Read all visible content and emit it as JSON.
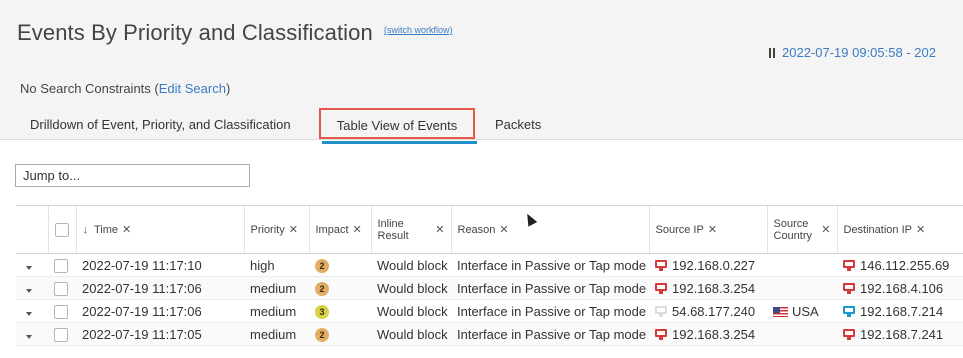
{
  "header": {
    "title": "Events By Priority and Classification",
    "switch_workflow": "(switch workflow)",
    "time_range": "2022-07-19 09:05:58 - 202",
    "constraints_prefix": "No Search Constraints (",
    "edit_search": "Edit Search",
    "constraints_suffix": ")"
  },
  "tabs": [
    {
      "label": "Drilldown of Event, Priority, and Classification"
    },
    {
      "label": "Table View of Events",
      "active": true
    },
    {
      "label": "Packets"
    }
  ],
  "jump_to": {
    "label": "Jump to..."
  },
  "table": {
    "columns": {
      "time": "Time",
      "priority": "Priority",
      "impact": "Impact",
      "inline_line1": "Inline",
      "inline_line2": "Result",
      "reason": "Reason",
      "source_ip": "Source IP",
      "source_country_line1": "Source",
      "source_country_line2": "Country",
      "destination_ip": "Destination IP"
    },
    "rows": [
      {
        "time": "2022-07-19 11:17:10",
        "priority": "high",
        "impact": "2",
        "inline_result": "Would block",
        "reason": "Interface in Passive or Tap mode",
        "source_ip": "192.168.0.227",
        "source_country": "",
        "destination_ip": "146.112.255.69"
      },
      {
        "time": "2022-07-19 11:17:06",
        "priority": "medium",
        "impact": "2",
        "inline_result": "Would block",
        "reason": "Interface in Passive or Tap mode",
        "source_ip": "192.168.3.254",
        "source_country": "",
        "destination_ip": "192.168.4.106"
      },
      {
        "time": "2022-07-19 11:17:06",
        "priority": "medium",
        "impact": "3",
        "inline_result": "Would block",
        "reason": "Interface in Passive or Tap mode",
        "source_ip": "54.68.177.240",
        "source_country": "USA",
        "destination_ip": "192.168.7.214"
      },
      {
        "time": "2022-07-19 11:17:05",
        "priority": "medium",
        "impact": "2",
        "inline_result": "Would block",
        "reason": "Interface in Passive or Tap mode",
        "source_ip": "192.168.3.254",
        "source_country": "",
        "destination_ip": "192.168.7.241"
      }
    ]
  },
  "colors": {
    "link": "#3a7cc4",
    "active_tab_border": "#e35a4a",
    "active_tab_underline": "#1f8fc7",
    "host_red": "#d53a3a",
    "host_blue": "#2196c9",
    "impact_2": "#e0ad63",
    "impact_3": "#d9d04a"
  },
  "icons": {
    "pause": "pause-icon",
    "sort": "sort-descending-icon",
    "remove": "close-icon",
    "expand": "chevron-down-icon",
    "host": "monitor-icon",
    "flag": "usa-flag-icon"
  }
}
